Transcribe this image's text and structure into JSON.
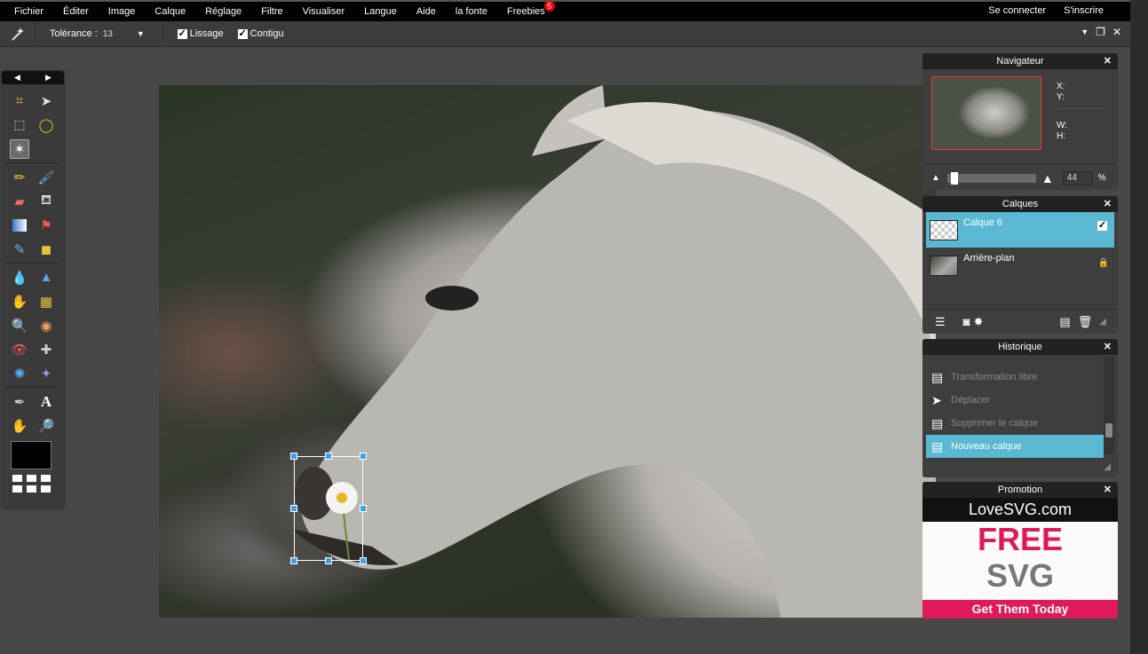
{
  "menubar": {
    "items": [
      "Fichier",
      "Éditer",
      "Image",
      "Calque",
      "Réglage",
      "Filtre",
      "Visualiser",
      "Langue",
      "Aide",
      "la fonte",
      "Freebies"
    ],
    "freebies_badge": "5",
    "right": [
      "Se connecter",
      "S'inscrire"
    ]
  },
  "options": {
    "tool_icon": "magic-wand-icon",
    "tolerance_label": "Tolérance :",
    "tolerance_value": "13",
    "lissage_label": "Lissage",
    "lissage_checked": true,
    "contigu_label": "Contigu",
    "contigu_checked": true
  },
  "toolbox": {
    "tools": [
      "crop",
      "move",
      "marquee",
      "lasso",
      "magic-wand",
      "pencil",
      "brush",
      "eraser",
      "paint-bucket",
      "gradient",
      "clone-stamp",
      "color-replace",
      "drawing",
      "blur",
      "sharpen",
      "smudge",
      "sponge",
      "dodge",
      "burn",
      "red-eye",
      "spot-heal",
      "bloat",
      "pinch",
      "color-picker",
      "type",
      "hand",
      "zoom"
    ],
    "active_tool": "magic-wand",
    "foreground_color": "#000000"
  },
  "navigator": {
    "title": "Navigateur",
    "x_label": "X:",
    "y_label": "Y:",
    "w_label": "W:",
    "h_label": "H:",
    "zoom": "44",
    "zoom_unit": "%"
  },
  "layers": {
    "title": "Calques",
    "items": [
      {
        "name": "Calque 6",
        "selected": true,
        "visible": true
      },
      {
        "name": "Arrière-plan",
        "selected": false,
        "locked": true
      }
    ]
  },
  "history": {
    "title": "Historique",
    "items": [
      "Transformation libre",
      "Déplacer",
      "Supprimer le calque",
      "Nouveau calque"
    ],
    "selected_index": 3
  },
  "promotion": {
    "title": "Promotion",
    "brand": "LoveSVG.com",
    "headline1": "FREE",
    "headline2": "SVG",
    "cta": "Get Them Today",
    "accent": "#e0195a"
  },
  "colors": {
    "selection_accent": "#5ab8d2",
    "handle": "#3ea0e8"
  }
}
